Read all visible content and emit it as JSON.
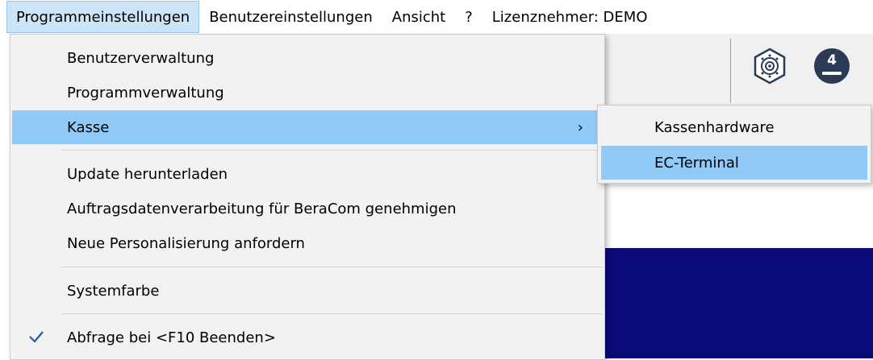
{
  "menubar": {
    "items": [
      {
        "label": "Programmeinstellungen"
      },
      {
        "label": "Benutzereinstellungen"
      },
      {
        "label": "Ansicht"
      },
      {
        "label": "?"
      },
      {
        "label": "Lizenznehmer: DEMO"
      }
    ]
  },
  "toolbar": {
    "icons": [
      "fingerprint-badge-icon",
      "number-badge-icon"
    ],
    "badge_number": "4"
  },
  "dropdown": {
    "items": [
      {
        "label": "Benutzerverwaltung"
      },
      {
        "label": "Programmverwaltung"
      },
      {
        "label": "Kasse",
        "submenu_arrow": "›"
      },
      {
        "label": "Update herunterladen"
      },
      {
        "label": "Auftragsdatenverarbeitung für BeraCom genehmigen"
      },
      {
        "label": "Neue Personalisierung anfordern"
      },
      {
        "label": "Systemfarbe"
      },
      {
        "label": "Abfrage bei <F10 Beenden>",
        "checked": true
      }
    ]
  },
  "submenu": {
    "items": [
      {
        "label": "Kassenhardware"
      },
      {
        "label": "EC-Terminal"
      }
    ]
  },
  "colors": {
    "highlight": "#91c9f7",
    "menubar_active": "#cce4f7",
    "app_dark_blue": "#0a0a78"
  }
}
